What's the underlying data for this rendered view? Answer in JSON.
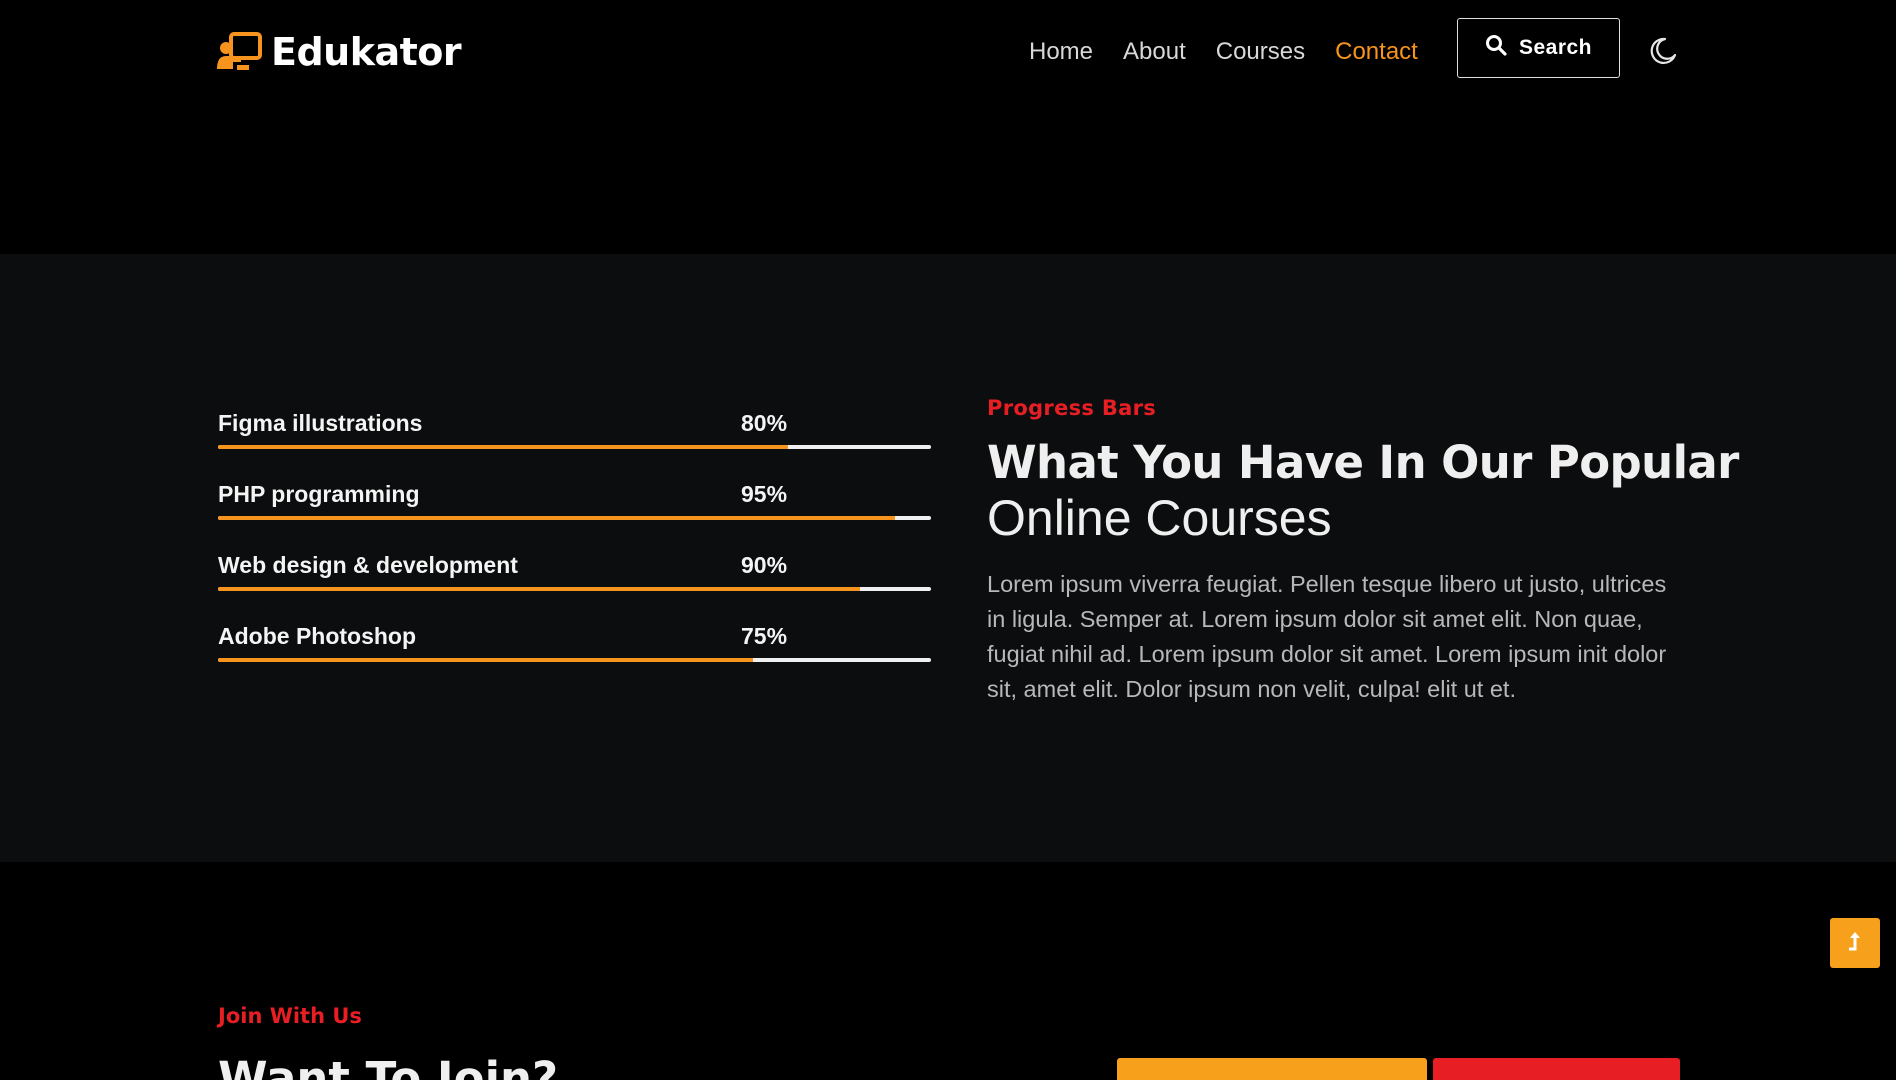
{
  "header": {
    "brand": "Edukator",
    "nav": [
      {
        "label": "Home",
        "active": false
      },
      {
        "label": "About",
        "active": false
      },
      {
        "label": "Courses",
        "active": false
      },
      {
        "label": "Contact",
        "active": true
      }
    ],
    "search_label": "Search",
    "theme_icon": "moon-icon"
  },
  "progress": {
    "bars": [
      {
        "label": "Figma illustrations",
        "percent_text": "80%",
        "value": 80
      },
      {
        "label": "PHP programming",
        "percent_text": "95%",
        "value": 95
      },
      {
        "label": "Web design & development",
        "percent_text": "90%",
        "value": 90
      },
      {
        "label": "Adobe Photoshop",
        "percent_text": "75%",
        "value": 75
      }
    ],
    "eyebrow": "Progress Bars",
    "heading_bold": "What You Have In Our Popular",
    "heading_light": "Online Courses",
    "paragraph": "Lorem ipsum viverra feugiat. Pellen tesque libero ut justo, ultrices in ligula. Semper at. Lorem ipsum dolor sit amet elit. Non quae, fugiat nihil ad. Lorem ipsum dolor sit amet. Lorem ipsum init dolor sit, amet elit. Dolor ipsum non velit, culpa! elit ut et."
  },
  "join": {
    "eyebrow": "Join With Us",
    "title": "Want To Join?"
  },
  "colors": {
    "accent": "#f7941d",
    "red": "#e81e25",
    "section_bg": "#0b0d0e"
  }
}
